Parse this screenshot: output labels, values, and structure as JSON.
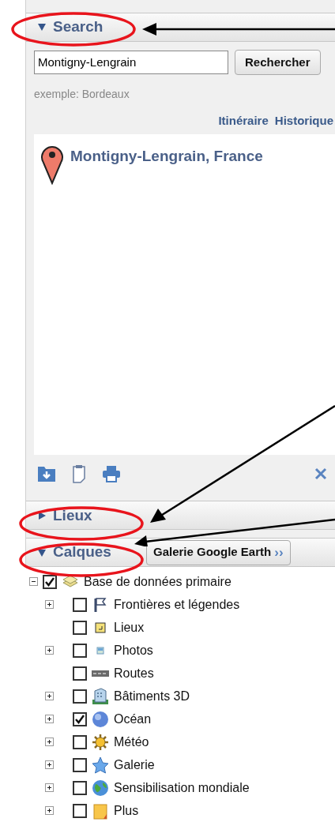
{
  "search": {
    "title": "Search",
    "expanded": true,
    "circled": true,
    "query": "Montigny-Lengrain",
    "button": "Rechercher",
    "hint": "exemple: Bordeaux",
    "links": [
      "Itinéraire",
      "Historique"
    ],
    "results": [
      {
        "title": "Montigny-Lengrain, France"
      }
    ]
  },
  "lieux": {
    "title": "Lieux",
    "expanded": false,
    "circled": true
  },
  "calques": {
    "title": "Calques",
    "expanded": true,
    "circled": true,
    "gallery_button": "Galerie Google Earth",
    "gallery_chevron": "››",
    "tree": [
      {
        "label": "Base de données primaire",
        "kind": "layers",
        "checked": true,
        "expanded": true,
        "children": [
          {
            "label": "Frontières et légendes",
            "kind": "flag",
            "checked": false,
            "expandable": true
          },
          {
            "label": "Lieux",
            "kind": "note",
            "checked": false,
            "expandable": false
          },
          {
            "label": "Photos",
            "kind": "photo",
            "checked": false,
            "expandable": true
          },
          {
            "label": "Routes",
            "kind": "road",
            "checked": false,
            "expandable": false
          },
          {
            "label": "Bâtiments 3D",
            "kind": "building",
            "checked": false,
            "expandable": true
          },
          {
            "label": "Océan",
            "kind": "globe",
            "checked": true,
            "expandable": true
          },
          {
            "label": "Météo",
            "kind": "sun",
            "checked": false,
            "expandable": true
          },
          {
            "label": "Galerie",
            "kind": "star",
            "checked": false,
            "expandable": true
          },
          {
            "label": "Sensibilisation mondiale",
            "kind": "earth",
            "checked": false,
            "expandable": true
          },
          {
            "label": "Plus",
            "kind": "folder",
            "checked": false,
            "expandable": true
          }
        ]
      }
    ]
  }
}
